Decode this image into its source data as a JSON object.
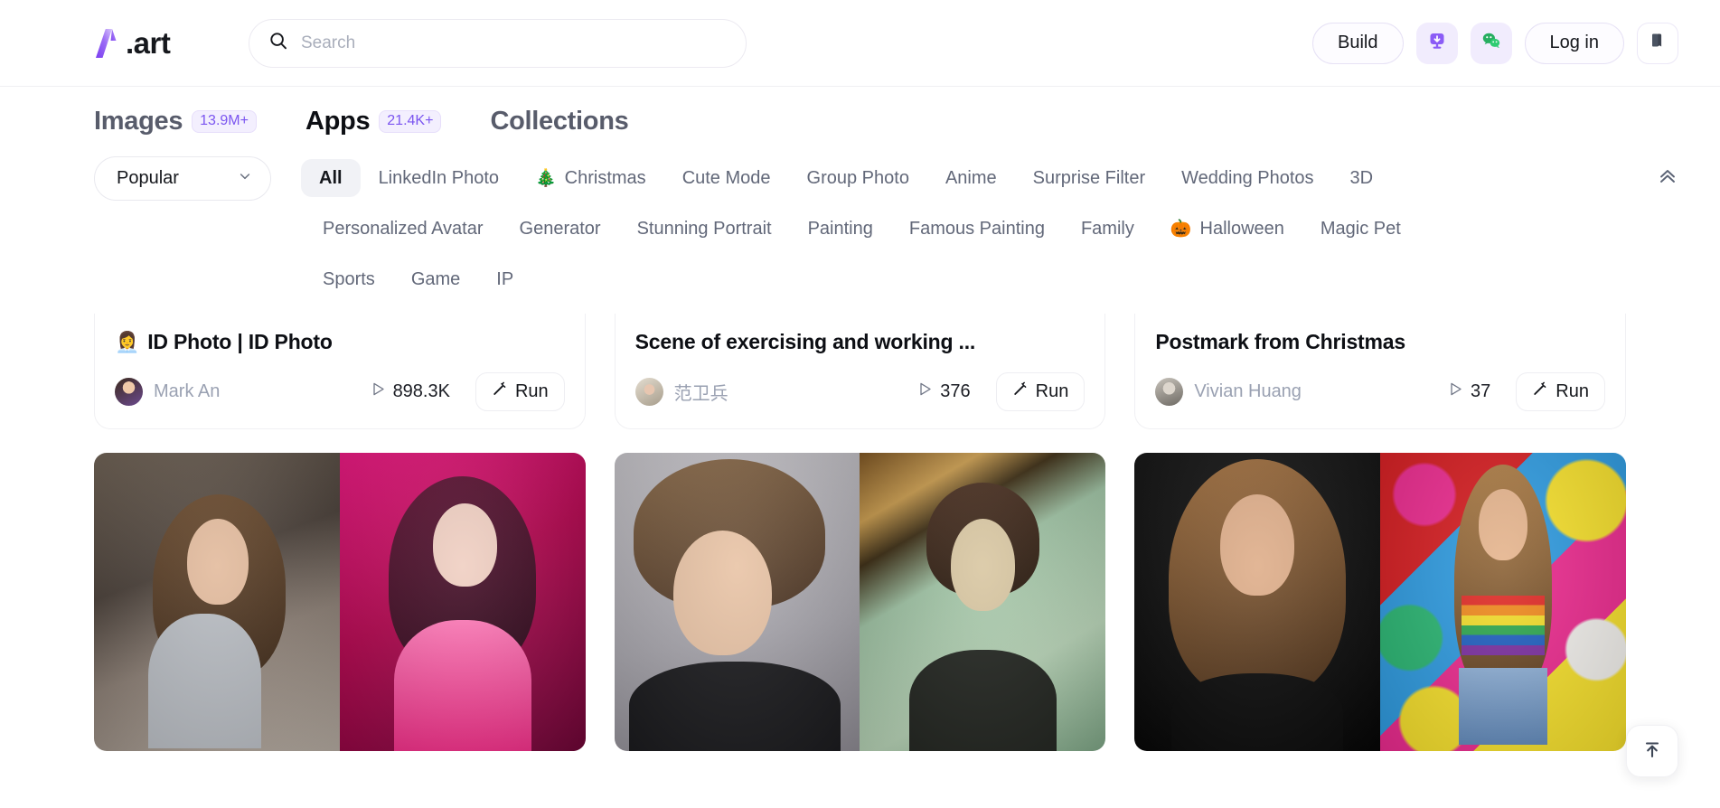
{
  "brand": {
    "logo_text": ".art",
    "logo_mark": "a-art-logo-icon"
  },
  "search": {
    "placeholder": "Search",
    "value": "",
    "icon": "search-icon"
  },
  "header_actions": {
    "build_label": "Build",
    "login_label": "Log in",
    "download_icon": "desktop-download-icon",
    "wechat_icon": "wechat-icon",
    "book_icon": "book-flag-icon"
  },
  "tabs": [
    {
      "label": "Images",
      "badge": "13.9M+",
      "active": false
    },
    {
      "label": "Apps",
      "badge": "21.4K+",
      "active": true
    },
    {
      "label": "Collections",
      "badge": "",
      "active": false
    }
  ],
  "sort": {
    "value": "Popular",
    "icon": "chevron-down-icon"
  },
  "collapse": {
    "icon": "double-chevron-up-icon"
  },
  "filter_rows": [
    [
      {
        "label": "All",
        "emoji": "",
        "active": true
      },
      {
        "label": "LinkedIn Photo",
        "emoji": "",
        "active": false
      },
      {
        "label": "Christmas",
        "emoji": "🎄",
        "active": false
      },
      {
        "label": "Cute Mode",
        "emoji": "",
        "active": false
      },
      {
        "label": "Group Photo",
        "emoji": "",
        "active": false
      },
      {
        "label": "Anime",
        "emoji": "",
        "active": false
      },
      {
        "label": "Surprise Filter",
        "emoji": "",
        "active": false
      },
      {
        "label": "Wedding Photos",
        "emoji": "",
        "active": false
      },
      {
        "label": "3D",
        "emoji": "",
        "active": false
      }
    ],
    [
      {
        "label": "Personalized Avatar",
        "emoji": "",
        "active": false
      },
      {
        "label": "Generator",
        "emoji": "",
        "active": false
      },
      {
        "label": "Stunning Portrait",
        "emoji": "",
        "active": false
      },
      {
        "label": "Painting",
        "emoji": "",
        "active": false
      },
      {
        "label": "Famous Painting",
        "emoji": "",
        "active": false
      },
      {
        "label": "Family",
        "emoji": "",
        "active": false
      },
      {
        "label": "Halloween",
        "emoji": "🎃",
        "active": false
      },
      {
        "label": "Magic Pet",
        "emoji": "",
        "active": false
      }
    ],
    [
      {
        "label": "Sports",
        "emoji": "",
        "active": false
      },
      {
        "label": "Game",
        "emoji": "",
        "active": false
      },
      {
        "label": "IP",
        "emoji": "",
        "active": false
      }
    ]
  ],
  "cards": [
    {
      "title": "ID Photo | ID Photo",
      "title_emoji": "👩‍💼",
      "author": "Mark An",
      "runs": "898.3K",
      "run_label": "Run"
    },
    {
      "title": "Scene of exercising and working ...",
      "title_emoji": "",
      "author": "范卫兵",
      "runs": "376",
      "run_label": "Run"
    },
    {
      "title": "Postmark from Christmas",
      "title_emoji": "",
      "author": "Vivian Huang",
      "runs": "37",
      "run_label": "Run"
    }
  ],
  "scroll_top": {
    "icon": "scroll-to-top-icon"
  },
  "colors": {
    "accent_purple": "#7b55f0",
    "badge_bg": "#f3effe",
    "wechat_green": "#2aae67",
    "text_primary": "#0d0f14",
    "text_muted": "#9aa1b2"
  }
}
